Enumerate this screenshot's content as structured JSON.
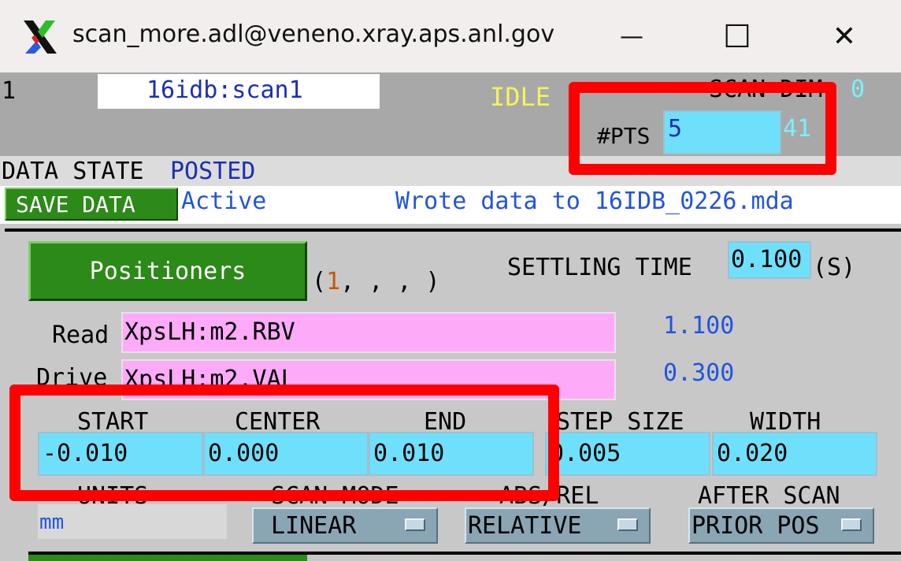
{
  "window": {
    "title": "scan_more.adl@veneno.xray.aps.anl.gov",
    "minimize_glyph": "—",
    "maximize_glyph": "☐",
    "close_glyph": "✕"
  },
  "header": {
    "index_number": "1",
    "scan_pv": "16idb:scan1",
    "status": "IDLE",
    "scan_dim_label": "SCAN DIM:",
    "scan_dim_value": "0",
    "npts_label": "#PTS",
    "npts_value": "5",
    "npts_max": "41"
  },
  "data_state": {
    "label": "DATA STATE",
    "value": "POSTED",
    "save_button": "SAVE DATA",
    "save_status": "Active",
    "message": "Wrote data to 16IDB_0226.mda"
  },
  "positioners": {
    "button": "Positioners",
    "list_open": "(",
    "active": "1",
    "list_rest": ", , , )",
    "settling_label": "SETTLING TIME",
    "settling_value": "0.100",
    "settling_unit": "(S)",
    "read_label": "Read",
    "read_pv": "XpsLH:m2.RBV",
    "read_value": "1.100",
    "drive_label": "Drive",
    "drive_pv": "XpsLH:m2.VAL",
    "drive_value": "0.300"
  },
  "params": {
    "start_label": "START",
    "start_value": "-0.010",
    "center_label": "CENTER",
    "center_value": "0.000",
    "end_label": "END",
    "end_value": "0.010",
    "step_label": "STEP SIZE",
    "step_value": "0.005",
    "width_label": "WIDTH",
    "width_value": "0.020"
  },
  "modes": {
    "units_label": "UNITS",
    "units_value": "mm",
    "scan_mode_label": "SCAN MODE",
    "scan_mode_value": "LINEAR",
    "abs_rel_label": "ABS/REL",
    "abs_rel_value": "RELATIVE",
    "after_scan_label": "AFTER SCAN",
    "after_scan_value": "PRIOR POS"
  },
  "colors": {
    "field_bg": "#6fe0fb",
    "pv_bg": "#fdaaf9",
    "button_green": "#2c8a18",
    "highlight_red": "#ff0000",
    "status_yellow": "#f5f35a",
    "link_blue": "#2255dd"
  }
}
